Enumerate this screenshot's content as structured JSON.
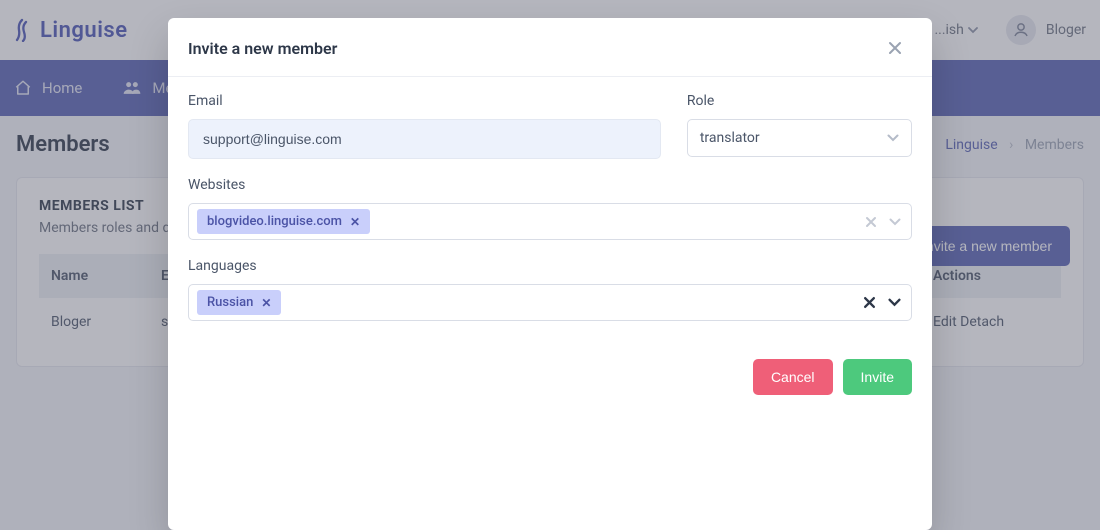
{
  "brand": "Linguise",
  "topbar": {
    "language_label": "...ish",
    "user_name": "Bloger"
  },
  "nav": {
    "home": "Home",
    "members": "Me..."
  },
  "page": {
    "title": "Members"
  },
  "breadcrumb": {
    "root": "Linguise",
    "sep": "›",
    "current": "Members"
  },
  "card": {
    "title": "MEMBERS LIST",
    "subtitle": "Members roles and do...",
    "invite_button": "Invite a new member"
  },
  "table": {
    "headers": {
      "name": "Name",
      "email": "Em",
      "actions": "Actions"
    },
    "rows": [
      {
        "name": "Bloger",
        "email": "sup",
        "actions": "Edit  Detach"
      }
    ]
  },
  "modal": {
    "title": "Invite a new member",
    "email_label": "Email",
    "email_value": "support@linguise.com",
    "role_label": "Role",
    "role_value": "translator",
    "websites_label": "Websites",
    "websites": [
      "blogvideo.linguise.com"
    ],
    "languages_label": "Languages",
    "languages": [
      "Russian"
    ],
    "cancel": "Cancel",
    "invite": "Invite"
  }
}
